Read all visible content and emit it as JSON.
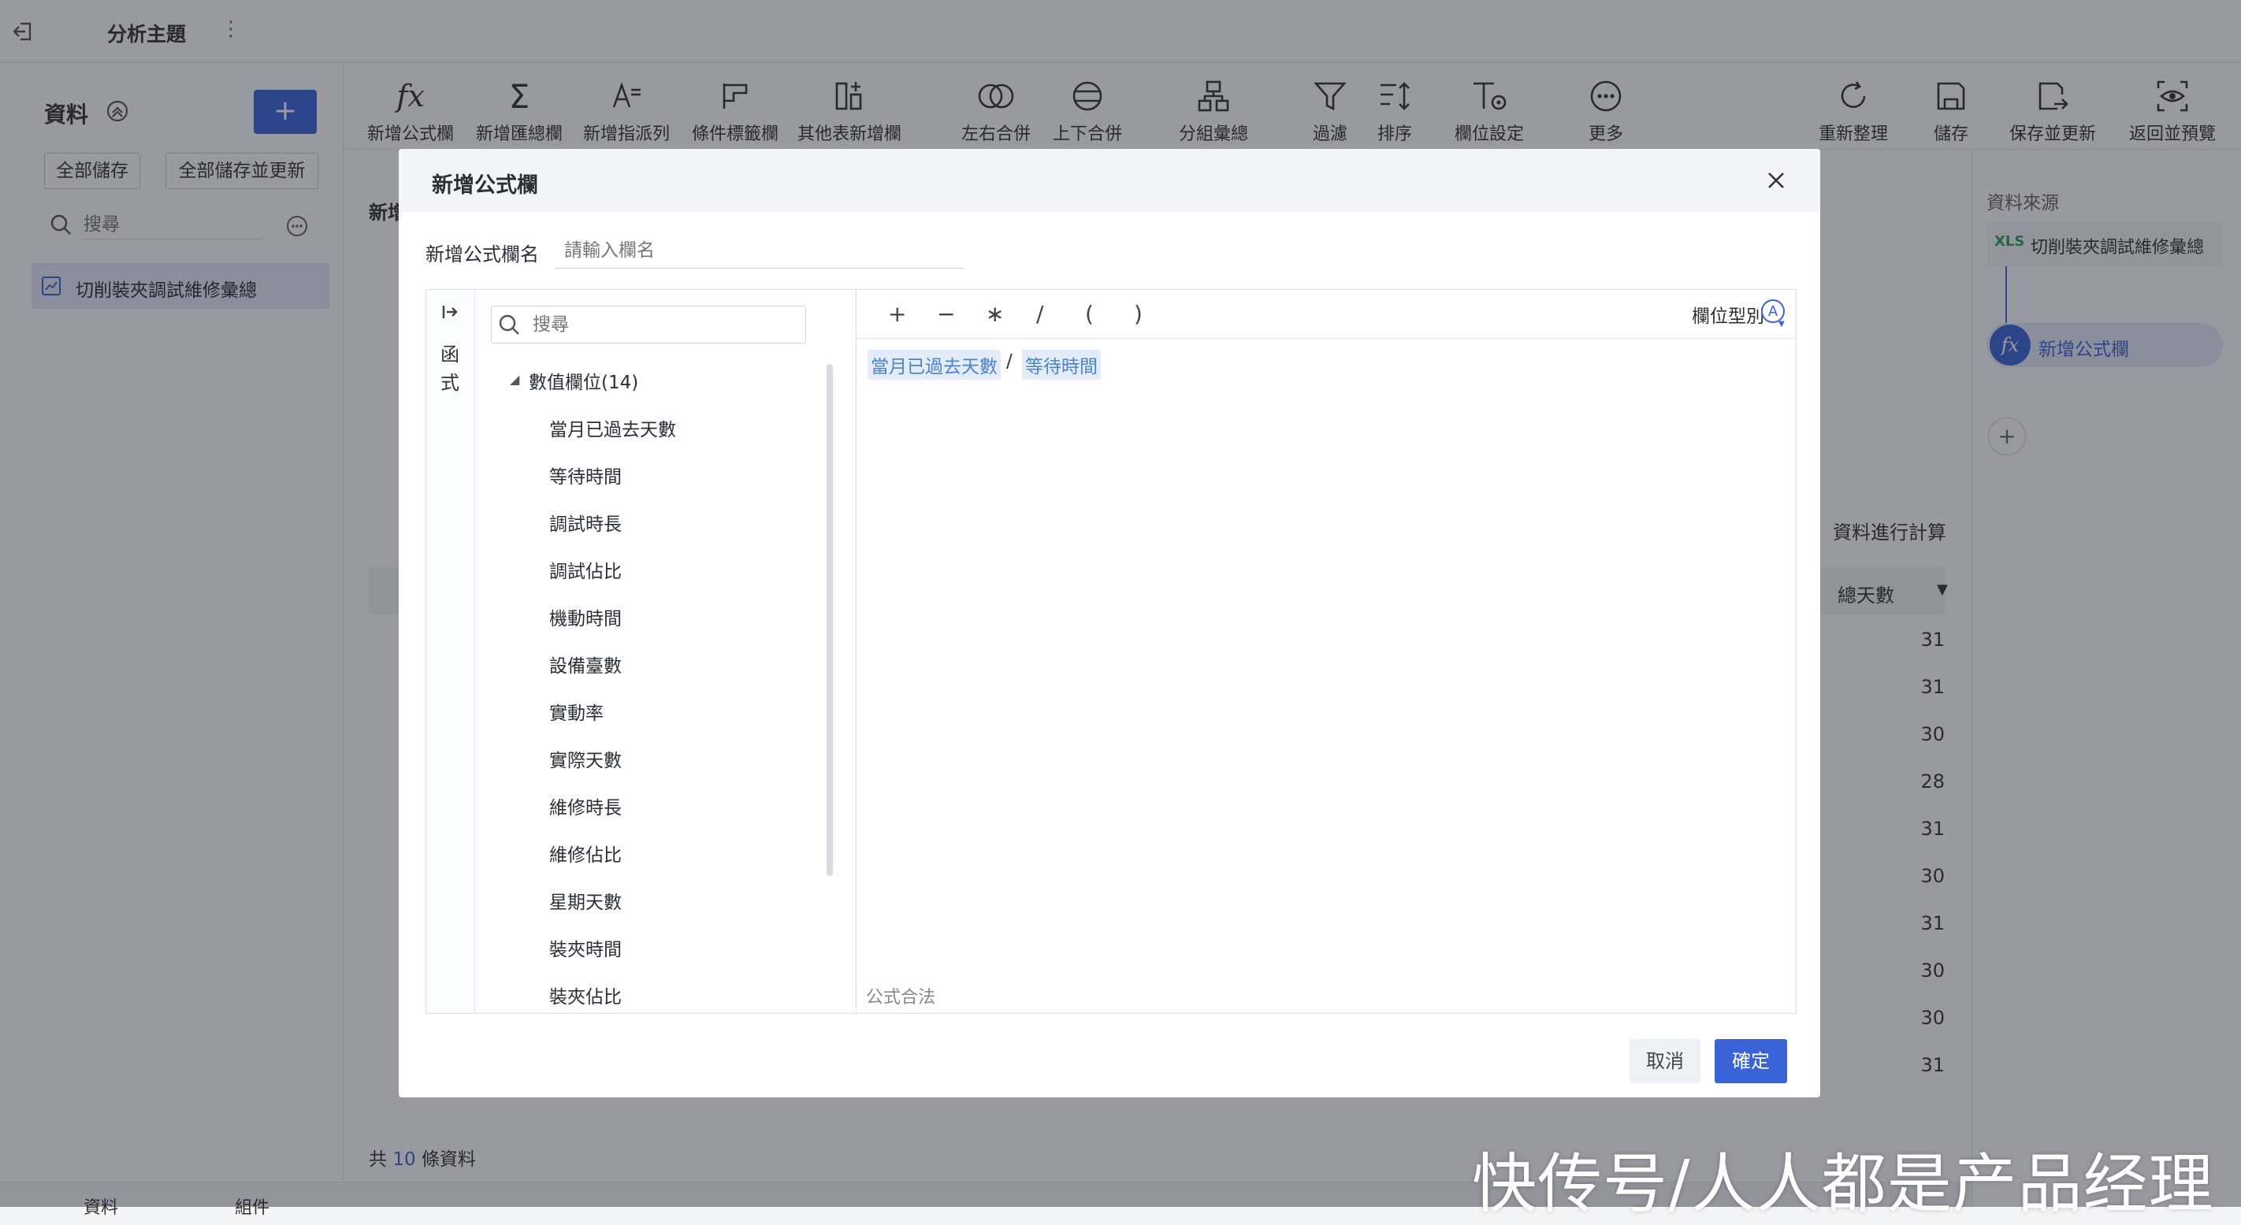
{
  "topbar": {
    "title": "分析主題",
    "more": "⋮"
  },
  "left": {
    "section_title": "資料",
    "add": "+",
    "save_all": "全部儲存",
    "save_all_update": "全部儲存並更新",
    "search_placeholder": "搜尋",
    "table_item": "切削裝夾調試維修彙總"
  },
  "toolbar": {
    "items": [
      {
        "label": "新增公式欄",
        "icon": "fx-icon"
      },
      {
        "label": "新增匯總欄",
        "icon": "sigma-icon"
      },
      {
        "label": "新增指派列",
        "icon": "assign-icon"
      },
      {
        "label": "條件標籤欄",
        "icon": "flag-icon"
      },
      {
        "label": "其他表新增欄",
        "icon": "add-column-icon"
      },
      {
        "label": "左右合併",
        "icon": "merge-lr-icon"
      },
      {
        "label": "上下合併",
        "icon": "merge-ud-icon"
      },
      {
        "label": "分組彙總",
        "icon": "group-icon"
      },
      {
        "label": "過濾",
        "icon": "filter-icon"
      },
      {
        "label": "排序",
        "icon": "sort-icon"
      },
      {
        "label": "欄位設定",
        "icon": "field-setting-icon"
      },
      {
        "label": "更多",
        "icon": "more-icon"
      }
    ],
    "right_items": [
      {
        "label": "重新整理",
        "icon": "refresh-icon"
      },
      {
        "label": "儲存",
        "icon": "save-icon"
      },
      {
        "label": "保存並更新",
        "icon": "save-update-icon"
      },
      {
        "label": "返回並預覽",
        "icon": "preview-icon"
      }
    ]
  },
  "background": {
    "new_label": "新增",
    "compute_label": "資料進行計算",
    "column_header": "總天數",
    "row_values": [
      "31",
      "31",
      "30",
      "28",
      "31",
      "30",
      "31",
      "30",
      "30",
      "31"
    ],
    "footer_prefix": "共",
    "footer_count": "10",
    "footer_suffix": "條資料",
    "bottom_tab_data": "資料",
    "bottom_tab_component": "組件"
  },
  "right_panel": {
    "title": "資料來源",
    "source_badge": "XLS",
    "source_name": "切削裝夾調試維修彙總",
    "step_label": "新增公式欄",
    "add": "+"
  },
  "modal": {
    "title": "新增公式欄",
    "name_label": "新增公式欄名",
    "name_placeholder": "請輸入欄名",
    "functions_tab": [
      "函",
      "式"
    ],
    "search_placeholder": "搜尋",
    "group_label": "數值欄位(14)",
    "fields": [
      "當月已過去天數",
      "等待時間",
      "調試時長",
      "調試佔比",
      "機動時間",
      "設備臺數",
      "實動率",
      "實際天數",
      "維修時長",
      "維修佔比",
      "星期天數",
      "裝夾時間",
      "裝夾佔比"
    ],
    "operators": [
      "+",
      "−",
      "∗",
      "/",
      "(",
      ")"
    ],
    "field_type_label": "欄位型別",
    "field_type_badge": "A",
    "formula": {
      "token1": "當月已過去天數",
      "op": "/",
      "token2": "等待時間"
    },
    "status": "公式合法",
    "cancel": "取消",
    "confirm": "確定"
  },
  "watermark": "快传号/人人都是产品经理",
  "colors": {
    "accent": "#3a63d8",
    "token_bg": "#e3edfa",
    "token_text": "#4f83c7"
  }
}
